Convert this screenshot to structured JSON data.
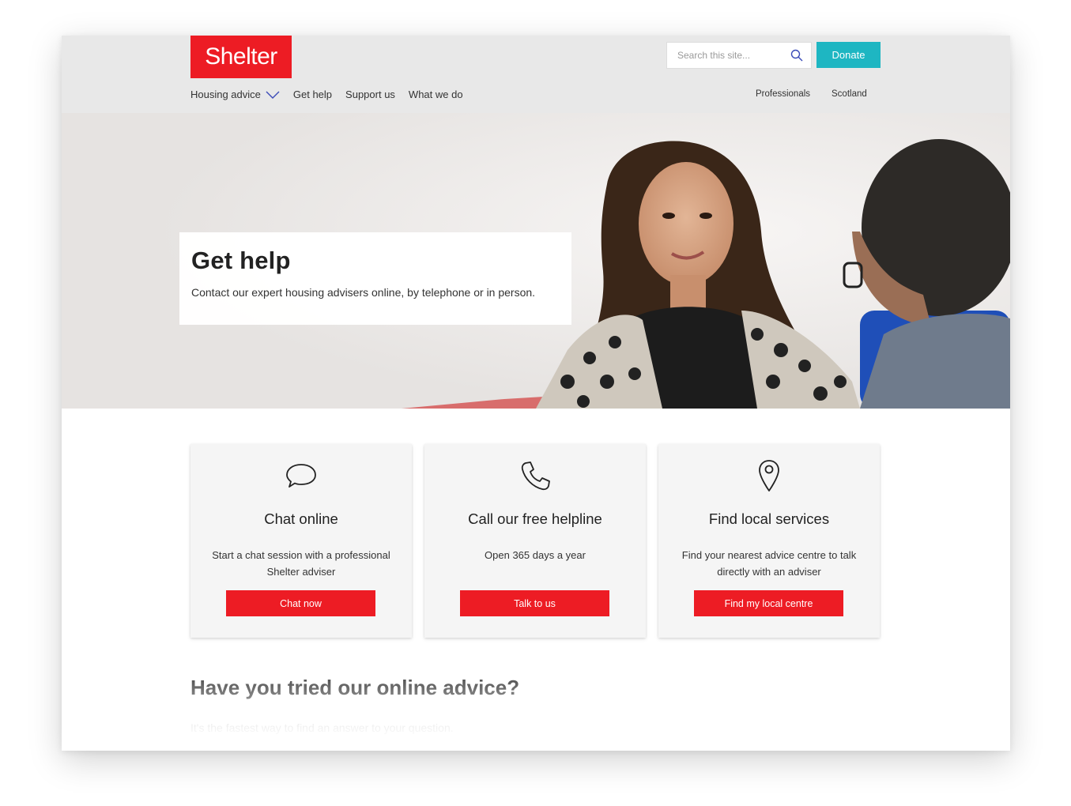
{
  "header": {
    "logo": "Shelter",
    "search_placeholder": "Search this site...",
    "donate_label": "Donate",
    "nav": [
      {
        "label": "Housing advice"
      },
      {
        "label": "Get help"
      },
      {
        "label": "Support us"
      },
      {
        "label": "What we do"
      }
    ],
    "nav_right": [
      {
        "label": "Professionals"
      },
      {
        "label": "Scotland"
      }
    ]
  },
  "hero": {
    "title": "Get help",
    "subtitle": "Contact our expert housing advisers online, by telephone or in person."
  },
  "cards": [
    {
      "icon": "chat-bubble-icon",
      "title": "Chat online",
      "text": "Start a chat session with a professional Shelter adviser",
      "button": "Chat now"
    },
    {
      "icon": "phone-icon",
      "title": "Call our free helpline",
      "text": "Open 365 days a year",
      "button": "Talk to us"
    },
    {
      "icon": "map-pin-icon",
      "title": "Find local services",
      "text": "Find your nearest advice centre to talk directly with an adviser",
      "button": "Find my local centre"
    }
  ],
  "advice": {
    "title": "Have you tried our online advice?",
    "subtitle": "It's the fastest way to find an answer to your question."
  },
  "colors": {
    "brand_red": "#ed1c24",
    "donate_teal": "#1eb6c2",
    "header_gray": "#e8e8e8"
  }
}
